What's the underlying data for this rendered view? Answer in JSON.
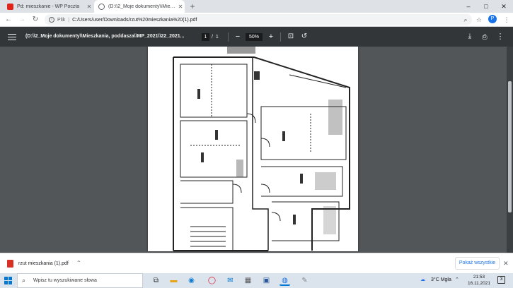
{
  "browser": {
    "tabs": [
      {
        "title": "Pd: mieszkanie - WP Poczta",
        "icon": "wp-mail-icon",
        "color": "#e2231a"
      },
      {
        "title": "(D:\\\\2_Moje dokumenty\\\\Mieszk",
        "icon": "globe-icon",
        "color": "#5f6368"
      }
    ],
    "new_tab_label": "+",
    "window_controls": {
      "minimize": "–",
      "maximize": "□",
      "close": "✕"
    },
    "address": {
      "scheme_label": "Plik",
      "url": "C:/Users/user/Downloads/rzut%20mieszkania%20(1).pdf"
    },
    "profile_initial": "P"
  },
  "pdf_viewer": {
    "title": "(D:\\\\2_Moje dokumenty\\\\Mieszkania, poddasza\\\\MP_2021\\\\22_2021...",
    "current_page": "1",
    "page_sep": "/",
    "total_pages": "1",
    "zoom": "50%",
    "zoom_out": "−",
    "zoom_in": "+"
  },
  "download_shelf": {
    "file_name": "rzut mieszkania (1).pdf",
    "show_all_label": "Pokaż wszystkie"
  },
  "taskbar": {
    "search_placeholder": "Wpisz tu wyszukiwane słowa",
    "weather": "3°C  Mgła",
    "time": "21:53",
    "date": "16.11.2021",
    "notification_count": "3"
  },
  "colors": {
    "pdf_toolbar": "#323639",
    "pdf_background": "#525659",
    "accent": "#1a73e8"
  }
}
